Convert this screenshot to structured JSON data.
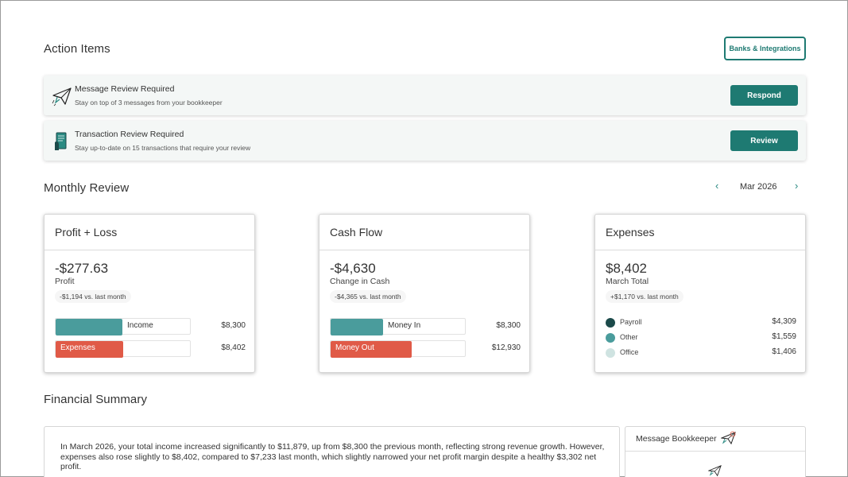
{
  "action_items": {
    "title": "Action Items",
    "banks_button": "Banks & Integrations",
    "items": [
      {
        "title": "Message Review Required",
        "description": "Stay on top of 3 messages from your bookkeeper",
        "button": "Respond",
        "icon": "paper-plane-icon"
      },
      {
        "title": "Transaction Review Required",
        "description": "Stay up-to-date on 15 transactions that require your review",
        "button": "Review",
        "icon": "receipt-icon"
      }
    ]
  },
  "monthly_review": {
    "title": "Monthly Review",
    "month": "Mar 2026",
    "prev_icon": "chevron-left-icon",
    "next_icon": "chevron-right-icon"
  },
  "profit_loss": {
    "title": "Profit + Loss",
    "amount": "-$277.63",
    "label": "Profit",
    "change": "-$1,194 vs. last month",
    "bars": [
      {
        "label": "Income",
        "value": "$8,300",
        "fill": 0.497,
        "color": "#4a9c9c"
      },
      {
        "label": "Expenses",
        "value": "$8,402",
        "fill": 0.503,
        "color": "#e05a47"
      }
    ]
  },
  "cash_flow": {
    "title": "Cash Flow",
    "amount": "-$4,630",
    "label": "Change in Cash",
    "change": "-$4,365 vs. last month",
    "bars": [
      {
        "label": "Money In",
        "value": "$8,300",
        "fill": 0.39,
        "color": "#4a9c9c"
      },
      {
        "label": "Money Out",
        "value": "$12,930",
        "fill": 0.605,
        "color": "#e05a47"
      }
    ]
  },
  "expenses": {
    "title": "Expenses",
    "amount": "$8,402",
    "label": "March Total",
    "change": "+$1,170 vs. last month",
    "items": [
      {
        "label": "Payroll",
        "value": "$4,309",
        "color": "#1b4a4a"
      },
      {
        "label": "Other",
        "value": "$1,559",
        "color": "#4a9c9c"
      },
      {
        "label": "Office",
        "value": "$1,406",
        "color": "#cfe3e1"
      }
    ]
  },
  "financial_summary": {
    "title": "Financial Summary",
    "text": "In March 2026, your total income increased significantly to $11,879, up from $8,300 the previous month, reflecting strong revenue growth. However, expenses also rose slightly to $8,402, compared to $7,233 last month, which slightly narrowed your net profit margin despite a healthy $3,302 net profit."
  },
  "message_bookkeeper": {
    "title": "Message Bookkeeper",
    "icon": "paper-plane-icon"
  },
  "colors": {
    "brand": "#1e7a72",
    "income": "#4a9c9c",
    "expense": "#e05a47"
  }
}
